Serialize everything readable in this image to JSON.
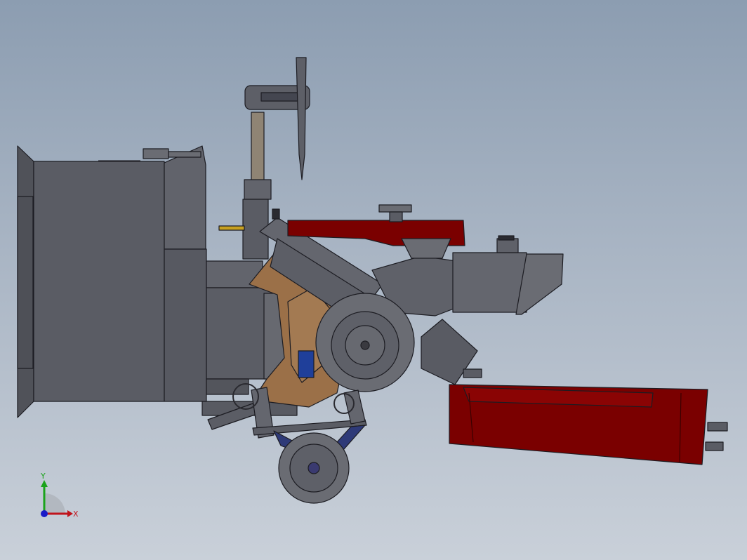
{
  "triad": {
    "y_label": "Y",
    "x_label": "X",
    "y_color": "#1ba31b",
    "x_color": "#c0141c",
    "z_color": "#1a1ac8"
  },
  "colors": {
    "body_gray": "#5e6068",
    "edge": "#1c1c22",
    "red": "#7a0000",
    "brown": "#9b7048",
    "blue": "#1f3f9a",
    "wheel": "#6a6c73"
  }
}
